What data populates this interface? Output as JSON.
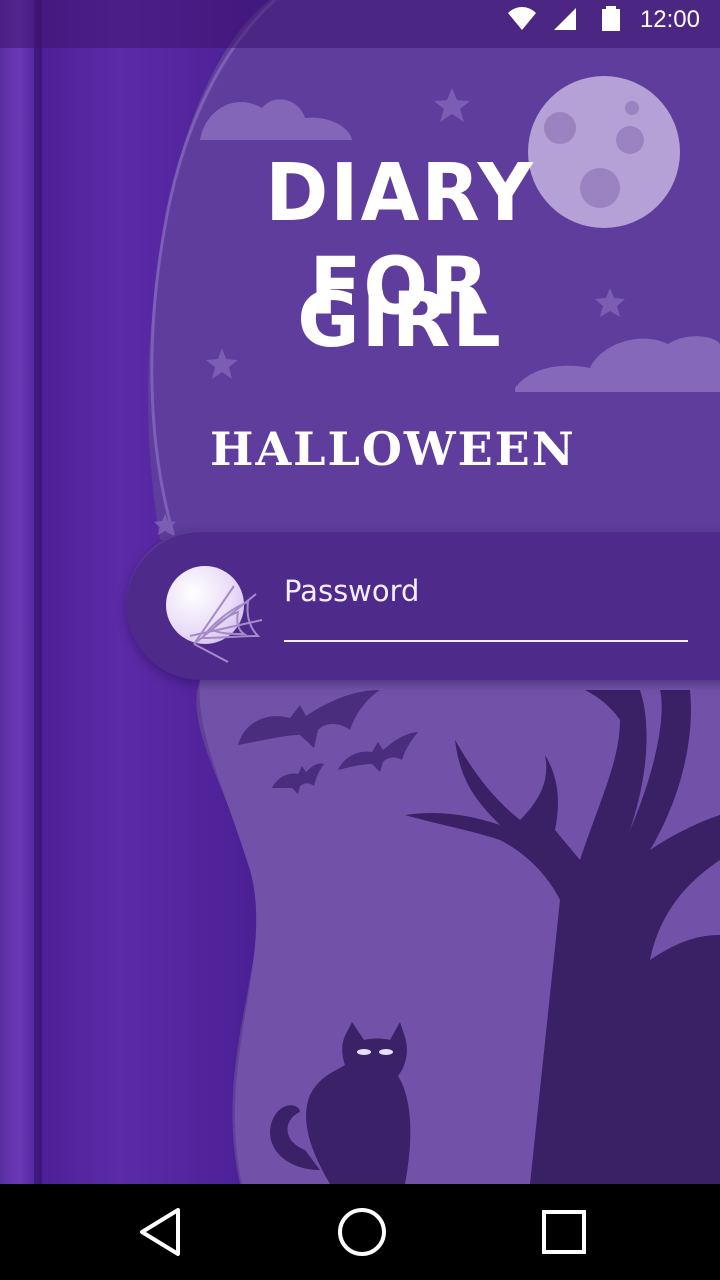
{
  "status_bar": {
    "time": "12:00",
    "icons": [
      "wifi-icon",
      "signal-icon",
      "battery-icon"
    ]
  },
  "app": {
    "title_line1": "DIARY FOR",
    "title_line2": "GIRL",
    "subtitle": "HALLOWEEN"
  },
  "login": {
    "password_placeholder": "Password",
    "password_value": "",
    "icon": "spider-web-icon"
  },
  "nav_bar": {
    "buttons": [
      "back-icon",
      "home-icon",
      "recents-icon"
    ]
  },
  "colors": {
    "spine": "#5b2ba8",
    "page": "#6d4fa3",
    "band": "#4e2a8a",
    "text": "#ffffff"
  }
}
